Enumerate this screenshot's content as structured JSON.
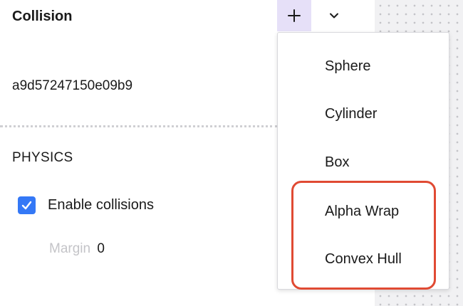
{
  "panel": {
    "title": "Collision",
    "object_id": "a9d57247150e09b9",
    "physics": {
      "section_title": "PHYSICS",
      "enable_collisions_label": "Enable collisions",
      "enable_collisions_checked": true,
      "margin_label": "Margin",
      "margin_value": "0"
    }
  },
  "toolbar": {
    "add_icon": "plus-icon",
    "menu_icon": "chevron-down-icon"
  },
  "menu": {
    "items": [
      {
        "label": "Sphere"
      },
      {
        "label": "Cylinder"
      },
      {
        "label": "Box"
      },
      {
        "label": "Alpha Wrap"
      },
      {
        "label": "Convex Hull"
      }
    ]
  },
  "colors": {
    "accent_button_bg": "#e6e0f8",
    "checkbox_blue": "#3478f6",
    "highlight_red": "#e04a33",
    "muted_text": "#c4c4c8"
  }
}
